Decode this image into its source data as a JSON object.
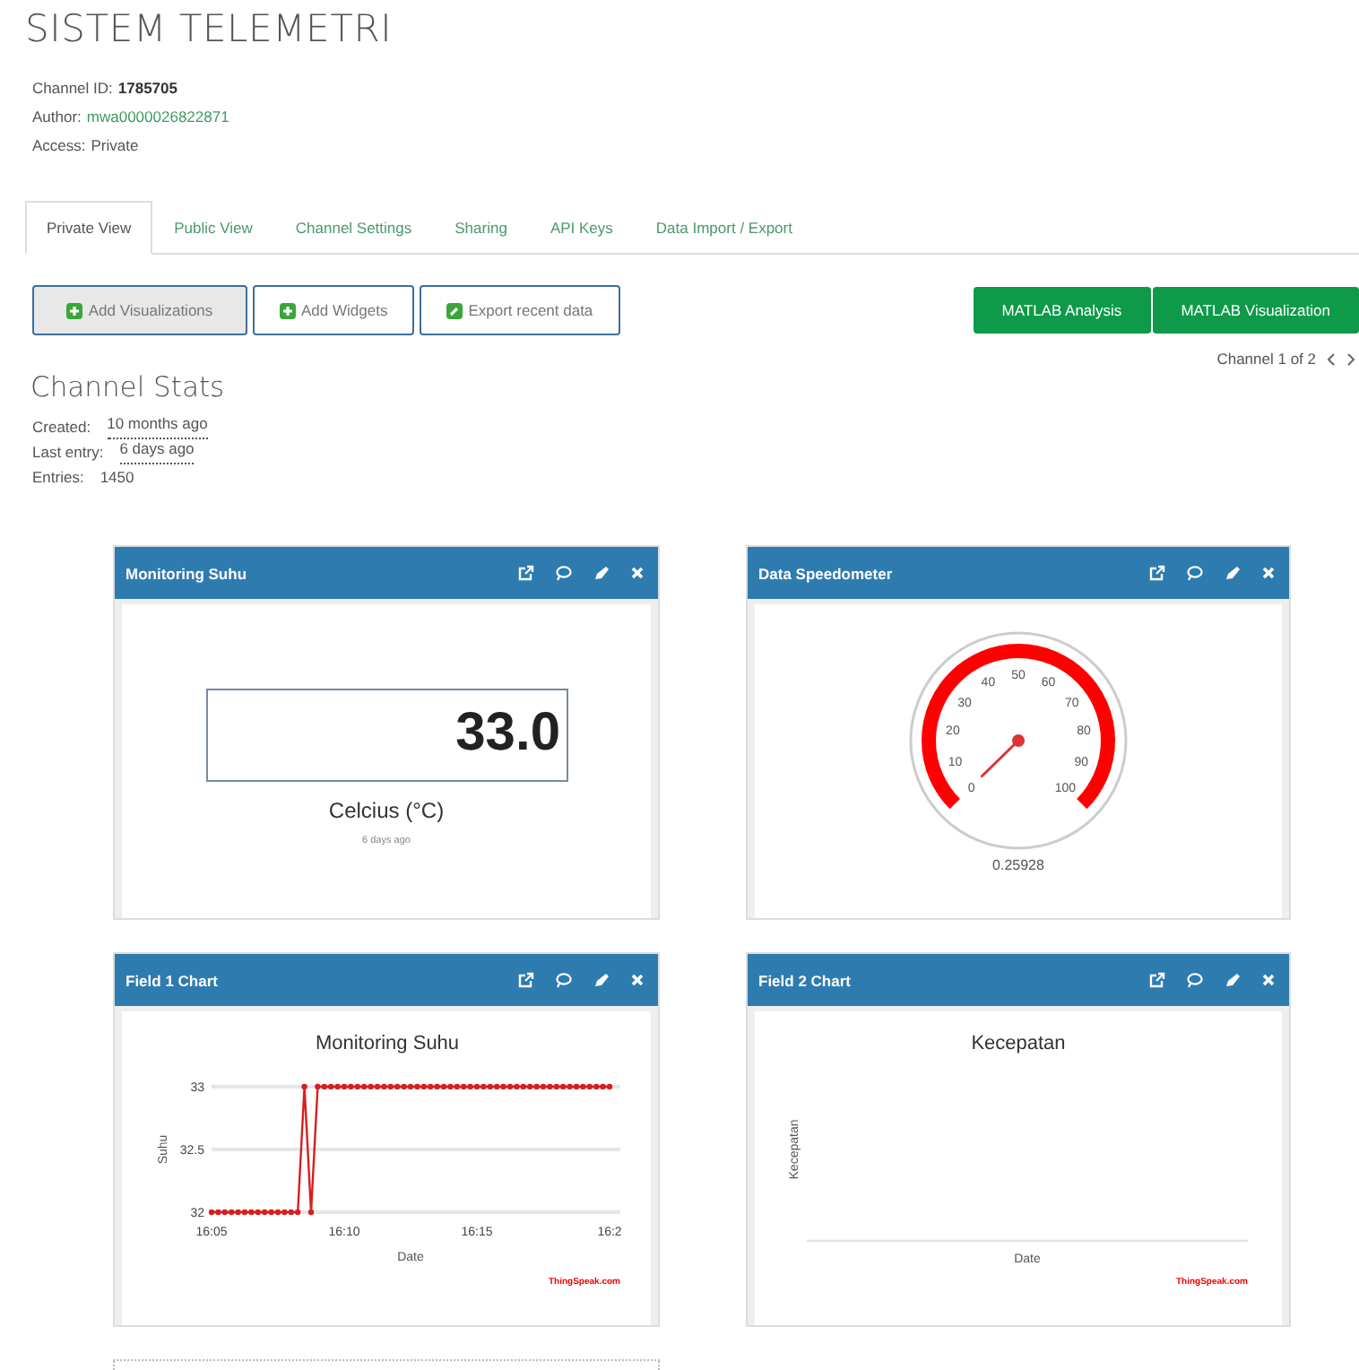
{
  "page": {
    "title": "SISTEM TELEMETRI"
  },
  "channel_info": [
    {
      "label": "Channel ID:",
      "value": "1785705",
      "kind": "bold"
    },
    {
      "label": "Author:",
      "value": "mwa0000026822871",
      "kind": "link"
    },
    {
      "label": "Access:",
      "value": "Private",
      "kind": "plain"
    }
  ],
  "tabs": [
    {
      "label": "Private View",
      "selected": true
    },
    {
      "label": "Public View",
      "selected": false
    },
    {
      "label": "Channel Settings",
      "selected": false
    },
    {
      "label": "Sharing",
      "selected": false
    },
    {
      "label": "API Keys",
      "selected": false
    },
    {
      "label": "Data Import / Export",
      "selected": false
    }
  ],
  "actions": [
    {
      "label": "Add Visualizations",
      "kind": "add",
      "active": true
    },
    {
      "label": "Add Widgets",
      "kind": "add",
      "active": false
    },
    {
      "label": "Export recent data",
      "kind": "export",
      "active": false
    }
  ],
  "matlab_buttons": [
    "MATLAB Analysis",
    "MATLAB Visualization"
  ],
  "pager": {
    "text": "Channel 1 of 2"
  },
  "stats": {
    "title": "Channel Stats",
    "items": [
      {
        "label": "Created:",
        "value": "10 months ago",
        "kind": "time"
      },
      {
        "label": "Last entry:",
        "value": "6 days ago",
        "kind": "time"
      },
      {
        "label": "Entries:",
        "value": "1450",
        "kind": "count"
      }
    ]
  },
  "widgets": [
    {
      "kind": "numeric",
      "title": "Monitoring Suhu",
      "value": "33.0",
      "unit": "Celcius (°C)",
      "updated": "6 days ago"
    },
    {
      "kind": "gauge",
      "title": "Data Speedometer",
      "scale": [
        "0",
        "10",
        "20",
        "30",
        "40",
        "50",
        "60",
        "70",
        "80",
        "90",
        "100"
      ],
      "reading": "0.25928"
    },
    {
      "kind": "chart",
      "title": "Field 1 Chart",
      "credit": "ThingSpeak.com",
      "chart_data": {
        "type": "line",
        "title": "Monitoring Suhu",
        "xlabel": "Date",
        "ylabel": "Suhu",
        "categories": [
          "16:05",
          null,
          null,
          null,
          null,
          null,
          null,
          null,
          null,
          null,
          null,
          null,
          null,
          null,
          null,
          null,
          null,
          null,
          null,
          null,
          "16:10",
          null,
          null,
          null,
          null,
          null,
          null,
          null,
          null,
          null,
          null,
          null,
          null,
          null,
          null,
          null,
          null,
          null,
          null,
          null,
          "16:15",
          null,
          null,
          null,
          null,
          null,
          null,
          null,
          null,
          null,
          null,
          null,
          null,
          null,
          null,
          null,
          null,
          null,
          null,
          null,
          "16:2"
        ],
        "series": [
          {
            "color": "#d62020",
            "marker": "circle",
            "values": [
              32,
              32,
              32,
              32,
              32,
              32,
              32,
              32,
              32,
              32,
              32,
              32,
              32,
              32,
              33,
              32,
              33,
              33,
              33,
              33,
              33,
              33,
              33,
              33,
              33,
              33,
              33,
              33,
              33,
              33,
              33,
              33,
              33,
              33,
              33,
              33,
              33,
              33,
              33,
              33,
              33,
              33,
              33,
              33,
              33,
              33,
              33,
              33,
              33,
              33,
              33,
              33,
              33,
              33,
              33,
              33,
              33,
              33,
              33,
              33,
              33
            ]
          }
        ],
        "ylim": [
          32,
          33
        ],
        "yticks": [
          32,
          32.5,
          33
        ]
      }
    },
    {
      "kind": "empty_chart",
      "title": "Field 2 Chart",
      "chart_title": "Kecepatan",
      "ylabel": "Kecepatan",
      "xlabel": "Date",
      "credit": "ThingSpeak.com"
    }
  ]
}
